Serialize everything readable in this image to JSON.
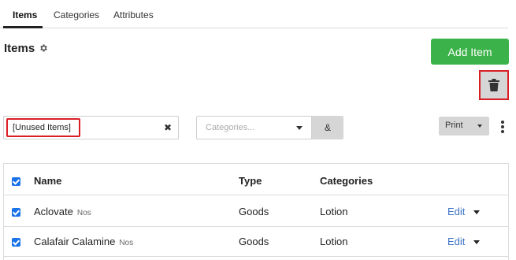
{
  "tabs": [
    {
      "label": "Items",
      "active": true
    },
    {
      "label": "Categories",
      "active": false
    },
    {
      "label": "Attributes",
      "active": false
    }
  ],
  "page": {
    "title": "Items",
    "settings_icon": "gear-icon"
  },
  "toolbar": {
    "add_label": "Add Item",
    "add_color": "#3cb34a",
    "delete_icon": "trash-icon",
    "highlight_color": "#d91f26"
  },
  "filters": {
    "search_tag": "[Unused Items]",
    "clear_icon": "close-icon",
    "category_placeholder": "Categories...",
    "and_label": "&",
    "print_label": "Print",
    "more_icon": "kebab-icon"
  },
  "table": {
    "headers": {
      "name": "Name",
      "type": "Type",
      "categories": "Categories"
    },
    "rows": [
      {
        "name": "Aclovate",
        "unit": "Nos",
        "type": "Goods",
        "category": "Lotion",
        "action": "Edit"
      },
      {
        "name": "Calafair Calamine",
        "unit": "Nos",
        "type": "Goods",
        "category": "Lotion",
        "action": "Edit"
      }
    ]
  }
}
